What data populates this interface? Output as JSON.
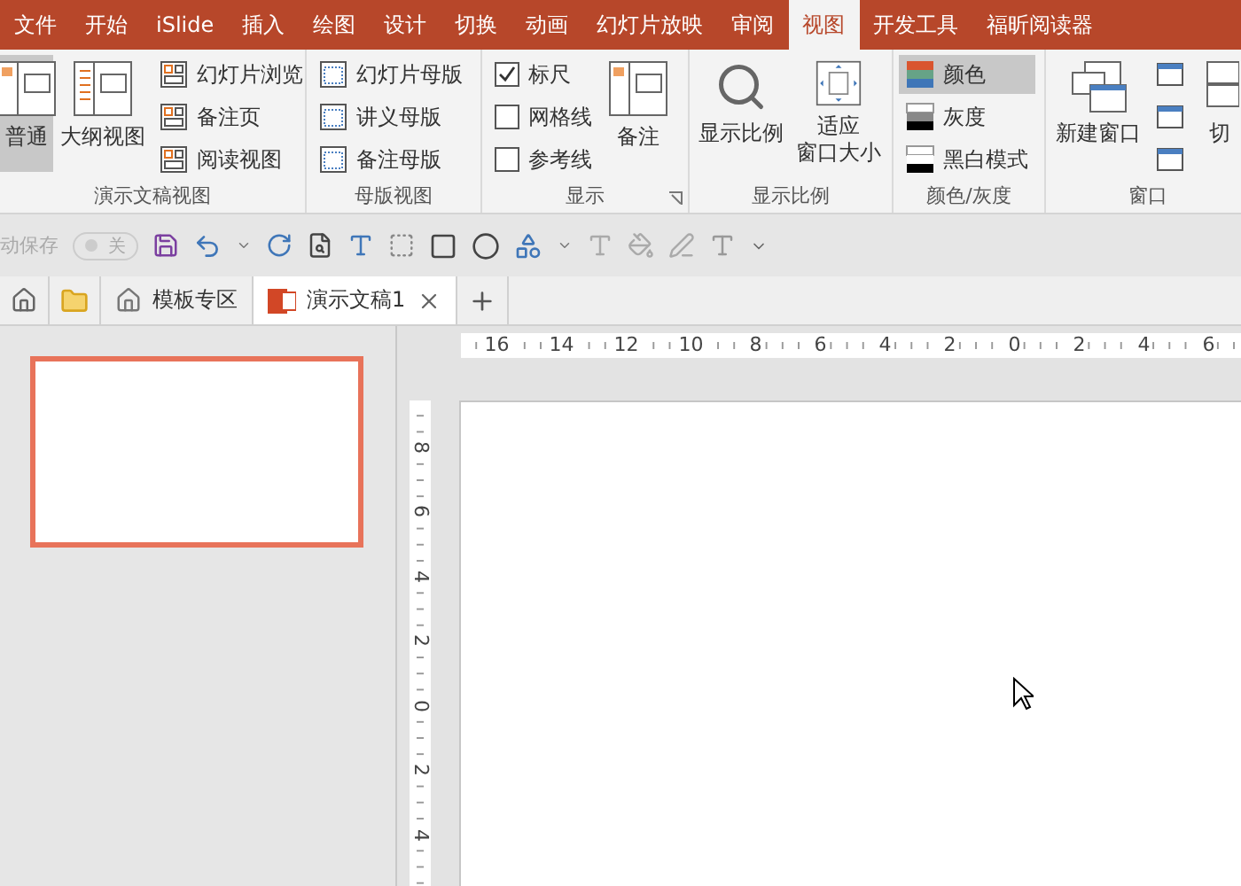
{
  "tabs": [
    {
      "label": "文件",
      "selected": false
    },
    {
      "label": "开始",
      "selected": false
    },
    {
      "label": "iSlide",
      "selected": false
    },
    {
      "label": "插入",
      "selected": false
    },
    {
      "label": "绘图",
      "selected": false
    },
    {
      "label": "设计",
      "selected": false
    },
    {
      "label": "切换",
      "selected": false
    },
    {
      "label": "动画",
      "selected": false
    },
    {
      "label": "幻灯片放映",
      "selected": false
    },
    {
      "label": "审阅",
      "selected": false
    },
    {
      "label": "视图",
      "selected": true
    },
    {
      "label": "开发工具",
      "selected": false
    },
    {
      "label": "福昕阅读器",
      "selected": false
    }
  ],
  "ribbon": {
    "presentation_views": {
      "title": "演示文稿视图",
      "normal": {
        "label": "普通",
        "selected": true
      },
      "outline": {
        "label": "大纲视图",
        "selected": false
      },
      "items": [
        "幻灯片浏览",
        "备注页",
        "阅读视图"
      ]
    },
    "master_views": {
      "title": "母版视图",
      "items": [
        "幻灯片母版",
        "讲义母版",
        "备注母版"
      ]
    },
    "show": {
      "title": "显示",
      "checkboxes": [
        {
          "label": "标尺",
          "checked": true
        },
        {
          "label": "网格线",
          "checked": false
        },
        {
          "label": "参考线",
          "checked": false
        }
      ],
      "notes": "备注"
    },
    "zoom": {
      "title": "显示比例",
      "zoom": "显示比例",
      "fit": [
        "适应",
        "窗口大小"
      ]
    },
    "color": {
      "title": "颜色/灰度",
      "options": [
        {
          "label": "颜色",
          "selected": true
        },
        {
          "label": "灰度",
          "selected": false
        },
        {
          "label": "黑白模式",
          "selected": false
        }
      ]
    },
    "window": {
      "title": "窗口",
      "new_window": "新建窗口",
      "switch": "切"
    }
  },
  "quick_access": {
    "autosave_label": "动保存",
    "autosave_toggle": "关"
  },
  "doc_tabs": [
    {
      "label": "模板专区",
      "selected": false
    },
    {
      "label": "演示文稿1",
      "selected": true
    }
  ],
  "rulers": {
    "horizontal": [
      "16",
      "14",
      "12",
      "10",
      "8",
      "6",
      "4",
      "2",
      "0",
      "2",
      "4",
      "6"
    ],
    "vertical": [
      "8",
      "6",
      "4",
      "2",
      "0",
      "2",
      "4"
    ]
  }
}
